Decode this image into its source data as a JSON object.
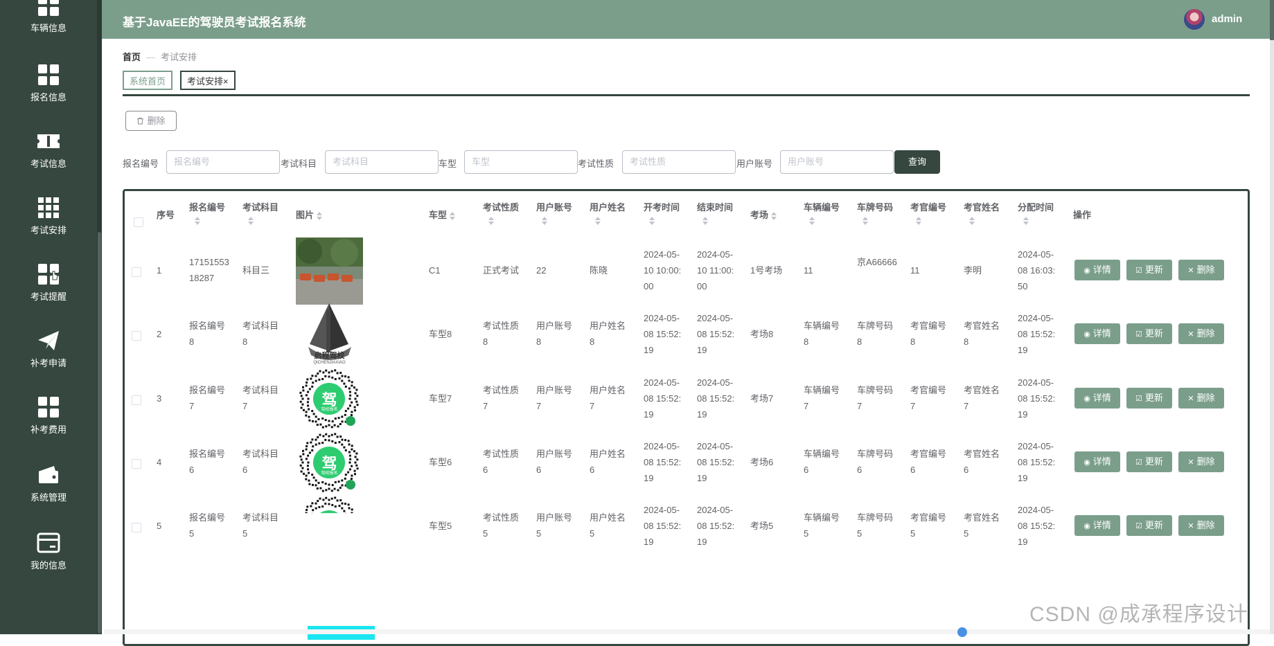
{
  "app": {
    "title": "基于JavaEE的驾驶员考试报名系统",
    "username": "admin"
  },
  "sidebar": {
    "items": [
      {
        "label": "车辆信息",
        "icon": "grid-icon"
      },
      {
        "label": "报名信息",
        "icon": "grid-icon"
      },
      {
        "label": "考试信息",
        "icon": "ticket-icon"
      },
      {
        "label": "考试安排",
        "icon": "grid9-icon"
      },
      {
        "label": "考试提醒",
        "icon": "grid-icon"
      },
      {
        "label": "补考申请",
        "icon": "send-icon"
      },
      {
        "label": "补考费用",
        "icon": "grid-icon"
      },
      {
        "label": "系统管理",
        "icon": "wallet-icon"
      },
      {
        "label": "我的信息",
        "icon": "card-icon"
      }
    ]
  },
  "breadcrumb": {
    "home": "首页",
    "sep": "—",
    "current": "考试安排"
  },
  "tabs": [
    {
      "label": "系统首页"
    },
    {
      "label": "考试安排",
      "close": "×"
    }
  ],
  "toolbar": {
    "delete_label": "删除"
  },
  "search": {
    "fields": [
      {
        "label": "报名编号",
        "placeholder": "报名编号"
      },
      {
        "label": "考试科目",
        "placeholder": "考试科目"
      },
      {
        "label": "车型",
        "placeholder": "车型"
      },
      {
        "label": "考试性质",
        "placeholder": "考试性质"
      },
      {
        "label": "用户账号",
        "placeholder": "用户账号"
      }
    ],
    "query_label": "查询"
  },
  "table": {
    "headers": [
      "序号",
      "报名编号",
      "考试科目",
      "图片",
      "车型",
      "考试性质",
      "用户账号",
      "用户姓名",
      "开考时间",
      "结束时间",
      "考场",
      "车辆编号",
      "车牌号码",
      "考官编号",
      "考官姓名",
      "分配时间",
      "操作"
    ],
    "rows": [
      [
        "1",
        "1715155318287",
        "科目三",
        "photo",
        "C1",
        "正式考试",
        "22",
        "陈晓",
        "2024-05-10 10:00:00",
        "2024-05-10 11:00:00",
        "1号考场",
        "11",
        "京A66666",
        "11",
        "李明",
        "2024-05-08 16:03:50"
      ],
      [
        "2",
        "报名编号8",
        "考试科目8",
        "logo",
        "车型8",
        "考试性质8",
        "用户账号8",
        "用户姓名8",
        "2024-05-08 15:52:19",
        "2024-05-08 15:52:19",
        "考场8",
        "车辆编号8",
        "车牌号码8",
        "考官编号8",
        "考官姓名8",
        "2024-05-08 15:52:19"
      ],
      [
        "3",
        "报名编号7",
        "考试科目7",
        "qr",
        "车型7",
        "考试性质7",
        "用户账号7",
        "用户姓名7",
        "2024-05-08 15:52:19",
        "2024-05-08 15:52:19",
        "考场7",
        "车辆编号7",
        "车牌号码7",
        "考官编号7",
        "考官姓名7",
        "2024-05-08 15:52:19"
      ],
      [
        "4",
        "报名编号6",
        "考试科目6",
        "qr",
        "车型6",
        "考试性质6",
        "用户账号6",
        "用户姓名6",
        "2024-05-08 15:52:19",
        "2024-05-08 15:52:19",
        "考场6",
        "车辆编号6",
        "车牌号码6",
        "考官编号6",
        "考官姓名6",
        "2024-05-08 15:52:19"
      ],
      [
        "5",
        "报名编号5",
        "考试科目5",
        "qr",
        "车型5",
        "考试性质5",
        "用户账号5",
        "用户姓名5",
        "2024-05-08 15:52:19",
        "2024-05-08 15:52:19",
        "考场5",
        "车辆编号5",
        "车牌号码5",
        "考官编号5",
        "考官姓名5",
        "2024-05-08 15:52:19"
      ]
    ],
    "actions": {
      "detail": "详情",
      "update": "更新",
      "delete": "删除"
    },
    "logo_text": "启程驾校",
    "logo_sub": "QICHENJIAXIAO",
    "qr_glyph": "驾",
    "qr_caption": "驾校报名"
  },
  "watermark": "CSDN @成承程序设计",
  "colors": {
    "sidebar": "#35473f",
    "header": "#7b9e8b",
    "accent": "#35473f",
    "action": "#7b9e8b"
  }
}
